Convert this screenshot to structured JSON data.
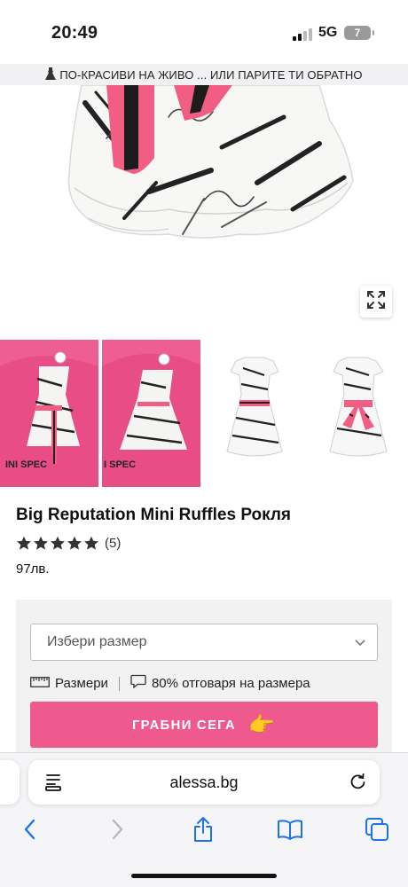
{
  "status_bar": {
    "time": "20:49",
    "network": "5G",
    "battery": "7"
  },
  "promo": {
    "icon": "dress-icon",
    "text": "ПО-КРАСИВИ НА ЖИВО ... ИЛИ ПАРИТЕ ТИ ОБРАТНО"
  },
  "gallery": {
    "expand_icon": "expand-icon",
    "thumbnails": [
      "photo-1",
      "photo-2",
      "photo-3",
      "photo-4"
    ]
  },
  "product": {
    "title": "Big Reputation Mini Ruffles Рокля",
    "rating_stars": 5,
    "review_count": "(5)",
    "price": "97лв."
  },
  "purchase": {
    "size_placeholder": "Избери размер",
    "size_chart_label": "Размери",
    "fit_label": "80% отговаря на размера",
    "buy_label": "ГРАБНИ СЕГА",
    "buy_emoji": "👉",
    "colors": {
      "buy_button": "#ee5a8e",
      "panel": "#f2f2f2"
    }
  },
  "browser": {
    "url": "alessa.bg",
    "toolbar_icons": [
      "back-icon",
      "forward-icon",
      "share-icon",
      "bookmarks-icon",
      "tabs-icon"
    ],
    "accent": "#1a73e8"
  }
}
